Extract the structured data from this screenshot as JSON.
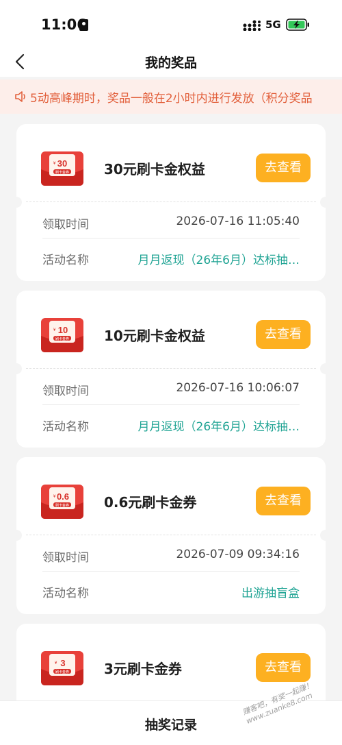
{
  "status": {
    "time": "11:06",
    "network": "5G"
  },
  "nav": {
    "title": "我的奖品"
  },
  "notice": {
    "text": "5动高峰期时，奖品一般在2小时内进行发放（积分奖品"
  },
  "prizes": [
    {
      "badge_value": "30",
      "badge_sub": "刷卡金券",
      "name": "30元刷卡金权益",
      "button": "去查看",
      "time_label": "领取时间",
      "time_value": "2026-07-16 11:05:40",
      "activity_label": "活动名称",
      "activity_value": "月月返现（26年6月）达标抽…"
    },
    {
      "badge_value": "10",
      "badge_sub": "刷卡金券",
      "name": "10元刷卡金权益",
      "button": "去查看",
      "time_label": "领取时间",
      "time_value": "2026-07-16 10:06:07",
      "activity_label": "活动名称",
      "activity_value": "月月返现（26年6月）达标抽…"
    },
    {
      "badge_value": "0.6",
      "badge_sub": "刷卡金券",
      "name": "0.6元刷卡金券",
      "button": "去查看",
      "time_label": "领取时间",
      "time_value": "2026-07-09 09:34:16",
      "activity_label": "活动名称",
      "activity_value": "出游抽盲盒"
    },
    {
      "badge_value": "3",
      "badge_sub": "刷卡金券",
      "name": "3元刷卡金券",
      "button": "去查看"
    }
  ],
  "bottom": {
    "label": "抽奖记录"
  },
  "watermark": {
    "line1": "赚客吧，有奖一起赚！",
    "line2": "www.zuanke8.com"
  },
  "colors": {
    "accent_button": "#fdb021",
    "notice_text": "#e2603c",
    "notice_bg": "#fdeeea",
    "link": "#1ea393",
    "badge_red": "#e8413a"
  },
  "icons": {
    "back": "chevron-left-icon",
    "notice": "speaker-icon",
    "signal": "signal-icon",
    "battery": "battery-charging-icon",
    "sim": "sim-card-icon"
  }
}
